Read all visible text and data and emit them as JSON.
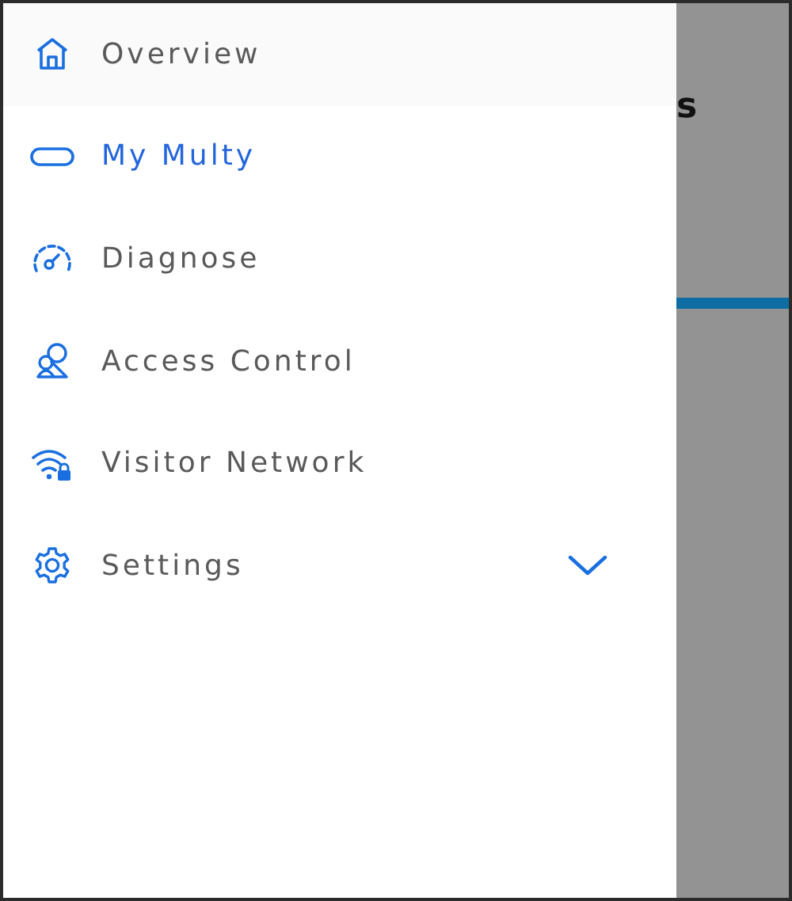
{
  "menu": {
    "items": [
      {
        "kind": "home",
        "label": "Overview",
        "selected": false
      },
      {
        "kind": "device",
        "label": "My Multy",
        "selected": true
      },
      {
        "kind": "gauge",
        "label": "Diagnose",
        "selected": false
      },
      {
        "kind": "people",
        "label": "Access Control",
        "selected": false
      },
      {
        "kind": "wifi-lock",
        "label": "Visitor Network",
        "selected": false
      },
      {
        "kind": "gear",
        "label": "Settings",
        "selected": false,
        "expanded": false
      }
    ]
  },
  "background_page": {
    "title": "s"
  }
}
